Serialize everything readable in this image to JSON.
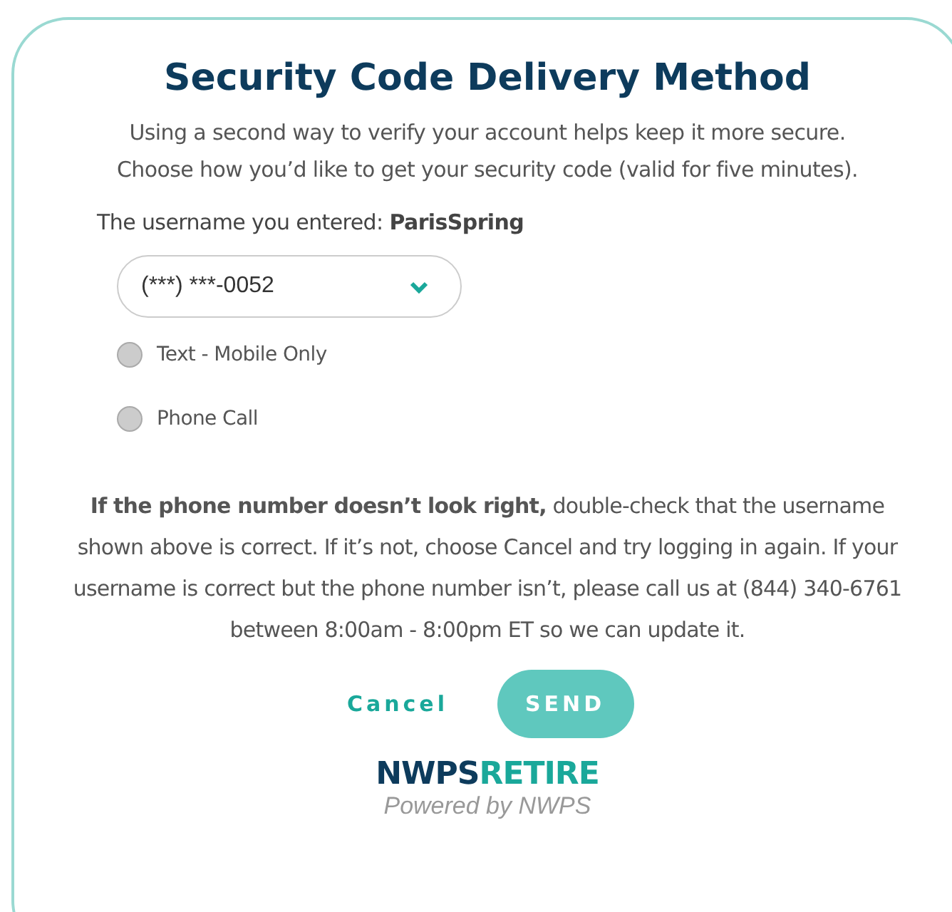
{
  "title": "Security Code Delivery Method",
  "intro": [
    "Using a second way to verify your account helps keep it more secure.",
    "Choose how you’d like to get your security code (valid for five minutes)."
  ],
  "username_line": "The username you entered: **ParisSpring**",
  "phone_select": {
    "value": "(***) ***-0052"
  },
  "options": [
    {
      "label": "Text - Mobile Only",
      "selected": false
    },
    {
      "label": "Phone Call",
      "selected": false
    }
  ],
  "notice": "**If the phone number doesn’t look right,** double-check that the username shown above is correct. If it’s not, choose Cancel and try logging in again. If your username is correct but the phone number isn’t, please call us at (844) 340-6761 between 8:00am - 8:00pm ET so we can update it.",
  "buttons": {
    "cancel": "Cancel",
    "send": "SEND"
  },
  "logo": {
    "part_1": "NWPS",
    "part_2": "RETIRE",
    "tagline": "Powered by NWPS"
  }
}
